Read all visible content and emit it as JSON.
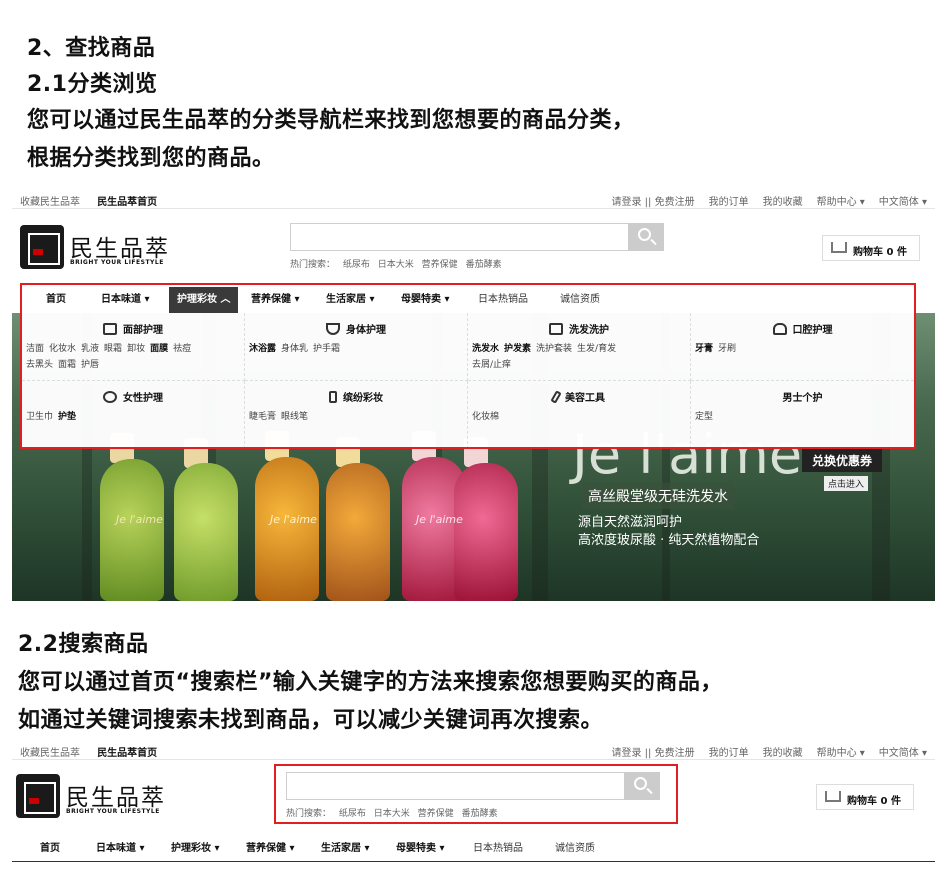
{
  "guide": {
    "h1": "2、查找商品",
    "h2": "2.1分类浏览",
    "p1": "您可以通过民生品萃的分类导航栏来找到您想要的商品分类，",
    "p2": "根据分类找到您的商品。",
    "h3": "2.2搜索商品",
    "p3": "您可以通过首页“搜索栏”输入关键字的方法来搜索您想要购买的商品，",
    "p4": "如通过关键词搜索未找到商品，可以减少关键词再次搜索。"
  },
  "topbar": {
    "fav": "收藏民生品萃",
    "home": "民生品萃首页",
    "login": "请登录",
    "sep": "||",
    "register": "免费注册",
    "orders": "我的订单",
    "favs": "我的收藏",
    "help": "帮助中心",
    "lang": "中文简体"
  },
  "logo": {
    "name": "民生品萃",
    "slogan": "BRIGHT YOUR  LIFESTYLE"
  },
  "search": {
    "hot_label": "热门搜索：",
    "hot": [
      "纸尿布",
      "日本大米",
      "营养保健",
      "番茄酵素"
    ]
  },
  "cart": {
    "label": "购物车",
    "count": "0",
    "unit": "件"
  },
  "nav": [
    "首页",
    "日本味道",
    "护理彩妆",
    "营养保健",
    "生活家居",
    "母婴特卖",
    "日本热销品",
    "诚信资质"
  ],
  "categories": [
    {
      "title": "面部护理",
      "items": [
        "洁面",
        "化妆水",
        "乳液",
        "眼霜",
        "卸妆",
        "面膜",
        "祛痘",
        "去黑头",
        "面霜",
        "护唇"
      ]
    },
    {
      "title": "身体护理",
      "items": [
        "沐浴露",
        "身体乳",
        "护手霜"
      ]
    },
    {
      "title": "洗发洗护",
      "items": [
        "洗发水",
        "护发素",
        "洗护套装",
        "生发/育发",
        "去屑/止痒"
      ]
    },
    {
      "title": "口腔护理",
      "items": [
        "牙膏",
        "牙刷"
      ]
    },
    {
      "title": "女性护理",
      "items": [
        "卫生巾",
        "护垫"
      ]
    },
    {
      "title": "缤纷彩妆",
      "items": [
        "睫毛膏",
        "眼线笔"
      ]
    },
    {
      "title": "美容工具",
      "items": [
        "化妆棉"
      ]
    },
    {
      "title": "男士个护",
      "items": [
        "定型"
      ]
    }
  ],
  "banner": {
    "brand": "Je l'aime",
    "brand_bottle": "Je l'aime",
    "tag": "兑换优惠券",
    "enter": "点击进入",
    "line1": "高丝殿堂级无硅洗发水",
    "line2": "源自天然滋润呵护",
    "line3": "高浓度玻尿酸 · 纯天然植物配合"
  },
  "colors": {
    "highlight": "#e02020",
    "nav_active": "#3a3a3a"
  }
}
